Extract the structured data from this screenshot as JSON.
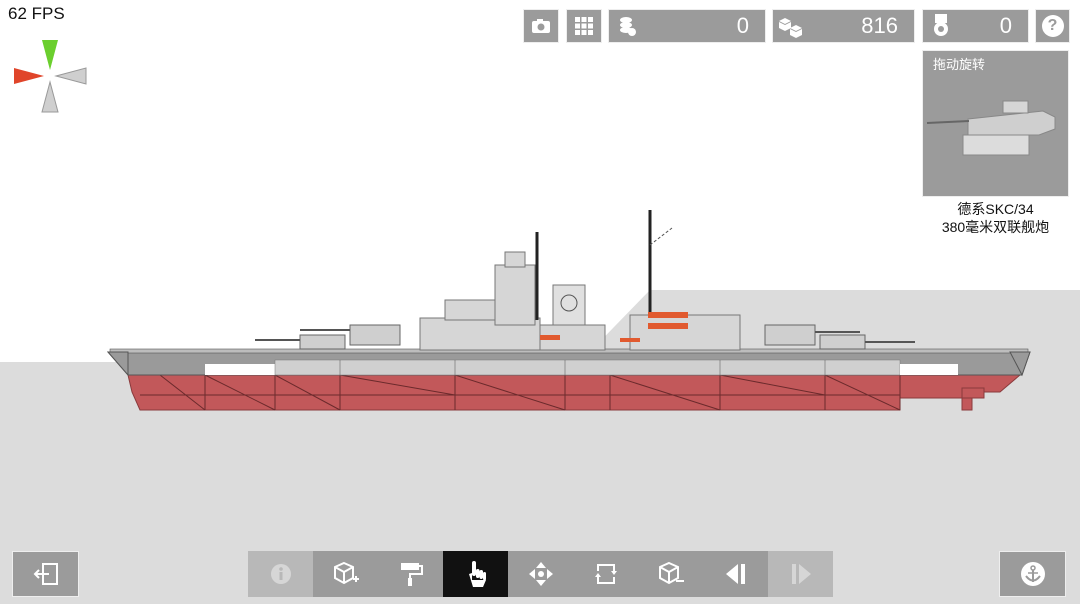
{
  "hud": {
    "fps": "62 FPS"
  },
  "topbar": {
    "coins": "0",
    "blocks": "816",
    "medals": "0",
    "help_label": "?"
  },
  "preview": {
    "title": "拖动旋转",
    "part_name_line1": "德系SKC/34",
    "part_name_line2": "380毫米双联舰炮"
  },
  "colors": {
    "button_bg": "#9b9b9b",
    "active_tool_bg": "#111111",
    "hull_red": "#c2585a",
    "superstructure": "#d6d6d6",
    "gizmo_x": "#e0452a",
    "gizmo_y": "#6bcf2e"
  },
  "toolbar": {
    "tools": [
      {
        "name": "info-tool",
        "icon": "info-icon",
        "state": "disabled"
      },
      {
        "name": "add-block-tool",
        "icon": "add-block-icon",
        "state": "normal"
      },
      {
        "name": "paint-tool",
        "icon": "paint-roller-icon",
        "state": "normal"
      },
      {
        "name": "select-tool",
        "icon": "hand-pointer-icon",
        "state": "active"
      },
      {
        "name": "move-tool",
        "icon": "move-arrows-icon",
        "state": "normal"
      },
      {
        "name": "rotate-tool",
        "icon": "rotate-icon",
        "state": "normal"
      },
      {
        "name": "delete-block-tool",
        "icon": "remove-block-icon",
        "state": "normal"
      },
      {
        "name": "undo-tool",
        "icon": "undo-icon",
        "state": "normal"
      },
      {
        "name": "redo-tool",
        "icon": "redo-icon",
        "state": "disabled"
      }
    ]
  }
}
